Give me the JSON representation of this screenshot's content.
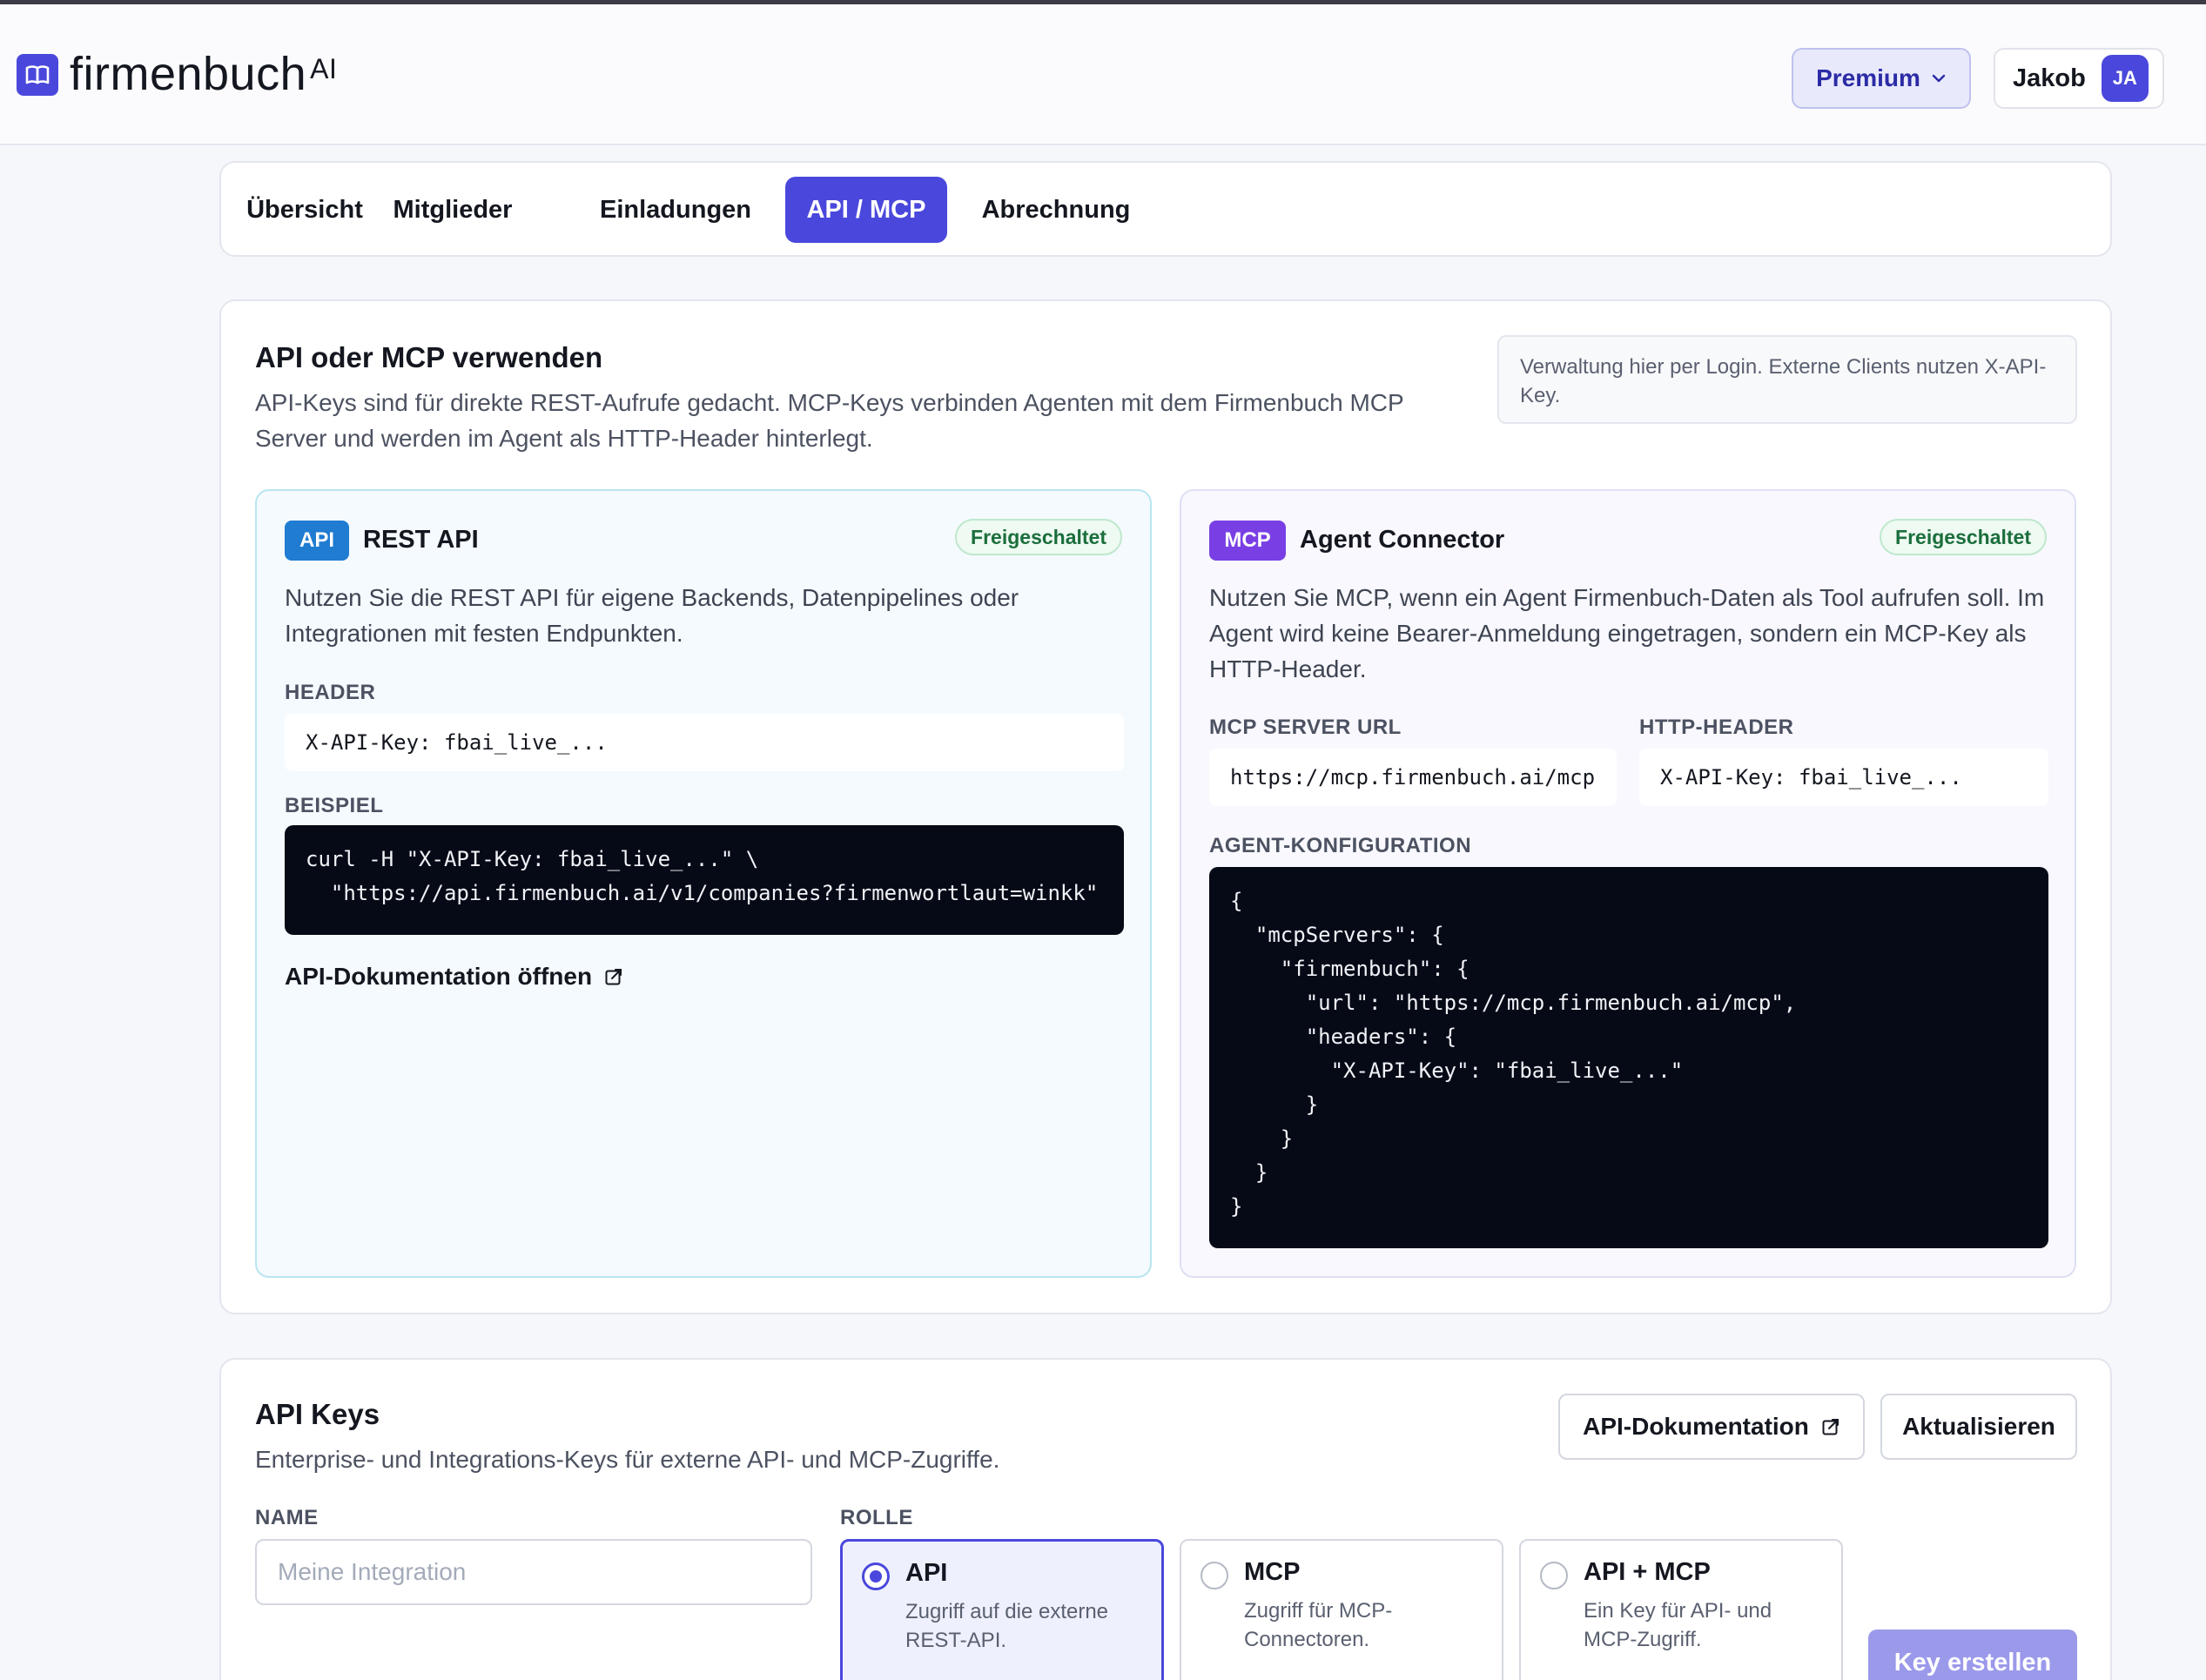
{
  "app": {
    "logo_text": "firmenbuch",
    "logo_sup": "AI",
    "plan_label": "Premium",
    "user_name": "Jakob",
    "user_initials": "JA"
  },
  "tabs": [
    {
      "label": "Übersicht",
      "active": false
    },
    {
      "label": "Mitglieder",
      "active": false
    },
    {
      "label": "Einladungen",
      "active": false
    },
    {
      "label": "API / MCP",
      "active": true
    },
    {
      "label": "Abrechnung",
      "active": false
    }
  ],
  "usage": {
    "title": "API oder MCP verwenden",
    "description": "API-Keys sind für direkte REST-Aufrufe gedacht. MCP-Keys verbinden Agenten mit dem Firmenbuch MCP Server und werden im Agent als HTTP-Header hinterlegt.",
    "note": "Verwaltung hier per Login. Externe Clients nutzen X-API-Key.",
    "rest": {
      "tag": "API",
      "title": "REST API",
      "status": "Freigeschaltet",
      "description": "Nutzen Sie die REST API für eigene Backends, Datenpipelines oder Integrationen mit festen Endpunkten.",
      "header_label": "HEADER",
      "header_value": "X-API-Key: fbai_live_...",
      "example_label": "BEISPIEL",
      "example_code": "curl -H \"X-API-Key: fbai_live_...\" \\\n  \"https://api.firmenbuch.ai/v1/companies?firmenwortlaut=winkk\"",
      "docs_link": "API-Dokumentation öffnen"
    },
    "mcp": {
      "tag": "MCP",
      "title": "Agent Connector",
      "status": "Freigeschaltet",
      "description": "Nutzen Sie MCP, wenn ein Agent Firmenbuch-Daten als Tool aufrufen soll. Im Agent wird keine Bearer-Anmeldung eingetragen, sondern ein MCP-Key als HTTP-Header.",
      "server_url_label": "MCP SERVER URL",
      "server_url": "https://mcp.firmenbuch.ai/mcp",
      "http_header_label": "HTTP-HEADER",
      "http_header": "X-API-Key: fbai_live_...",
      "config_label": "AGENT-KONFIGURATION",
      "config_code": "{\n  \"mcpServers\": {\n    \"firmenbuch\": {\n      \"url\": \"https://mcp.firmenbuch.ai/mcp\",\n      \"headers\": {\n        \"X-API-Key\": \"fbai_live_...\"\n      }\n    }\n  }\n}"
    }
  },
  "keys": {
    "title": "API Keys",
    "description": "Enterprise- und Integrations-Keys für externe API- und MCP-Zugriffe.",
    "docs_button": "API-Dokumentation",
    "refresh_button": "Aktualisieren",
    "name_label": "NAME",
    "name_placeholder": "Meine Integration",
    "name_value": "",
    "role_label": "ROLLE",
    "roles": [
      {
        "title": "API",
        "desc": "Zugriff auf die externe REST-API.",
        "selected": true
      },
      {
        "title": "MCP",
        "desc": "Zugriff für MCP-Connectoren.",
        "selected": false
      },
      {
        "title": "API + MCP",
        "desc": "Ein Key für API- und MCP-Zugriff.",
        "selected": false
      }
    ],
    "create_button": "Key erstellen"
  },
  "colors": {
    "accent": "#4a48dc",
    "api_tag": "#1f7cd1",
    "mcp_tag": "#7a3fe4",
    "status_green": "#1b6e3c",
    "code_bg": "#060a17"
  },
  "icons": {
    "logo": "book-icon",
    "dropdown": "chevron-down-icon",
    "external": "external-link-icon"
  }
}
